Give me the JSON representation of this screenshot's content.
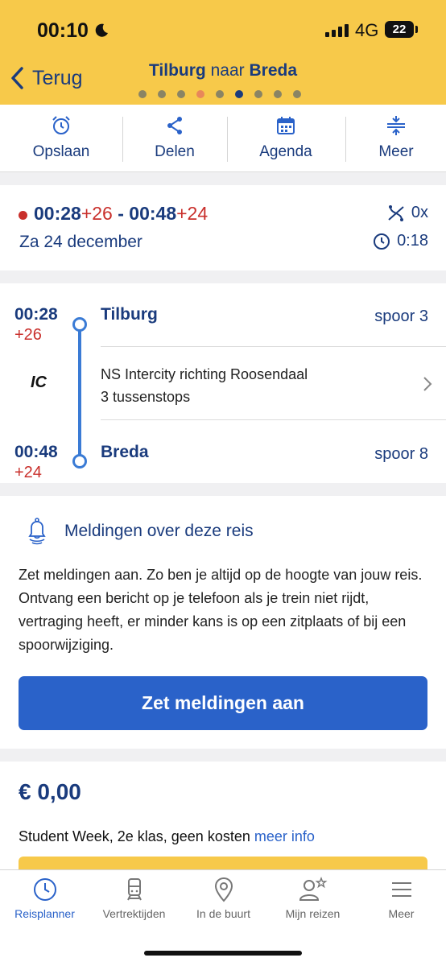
{
  "status_bar": {
    "time": "00:10",
    "network": "4G",
    "battery": "22"
  },
  "header": {
    "back_label": "Terug",
    "title_from": "Tilburg",
    "title_mid": "naar",
    "title_to": "Breda"
  },
  "actions": [
    {
      "label": "Opslaan",
      "icon": "alarm-icon"
    },
    {
      "label": "Delen",
      "icon": "share-icon"
    },
    {
      "label": "Agenda",
      "icon": "calendar-icon"
    },
    {
      "label": "Meer",
      "icon": "expand-icon"
    }
  ],
  "summary": {
    "depart": "00:28",
    "depart_delay": "+26",
    "separator": "-",
    "arrive": "00:48",
    "arrive_delay": "+24",
    "date": "Za 24 december",
    "transfers": "0x",
    "duration": "0:18"
  },
  "leg": {
    "from_time": "00:28",
    "from_delay": "+26",
    "from_station": "Tilburg",
    "from_track": "spoor 3",
    "train_type": "IC",
    "train_desc": "NS Intercity richting Roosendaal",
    "stops": "3 tussenstops",
    "to_time": "00:48",
    "to_delay": "+24",
    "to_station": "Breda",
    "to_track": "spoor 8"
  },
  "notifications": {
    "title": "Meldingen over deze reis",
    "text": "Zet meldingen aan. Zo ben je altijd op de hoogte van jouw reis. Ontvang een bericht op je telefoon als je trein niet rijdt, vertraging heeft, er minder kans is op een zitplaats of bij een spoorwijziging.",
    "button": "Zet meldingen aan"
  },
  "price": {
    "value": "€ 0,00",
    "ticket": "Student Week, 2e klas, geen kosten",
    "link": "meer info"
  },
  "tabs": [
    {
      "label": "Reisplanner",
      "icon": "clock-icon",
      "active": true
    },
    {
      "label": "Vertrektijden",
      "icon": "train-icon",
      "active": false
    },
    {
      "label": "In de buurt",
      "icon": "location-pin-icon",
      "active": false
    },
    {
      "label": "Mijn reizen",
      "icon": "person-star-icon",
      "active": false
    },
    {
      "label": "Meer",
      "icon": "menu-icon",
      "active": false
    }
  ],
  "colors": {
    "brand_yellow": "#f7c94a",
    "navy": "#1a3b7d",
    "blue": "#2a62c9",
    "delay_red": "#c9302c"
  }
}
